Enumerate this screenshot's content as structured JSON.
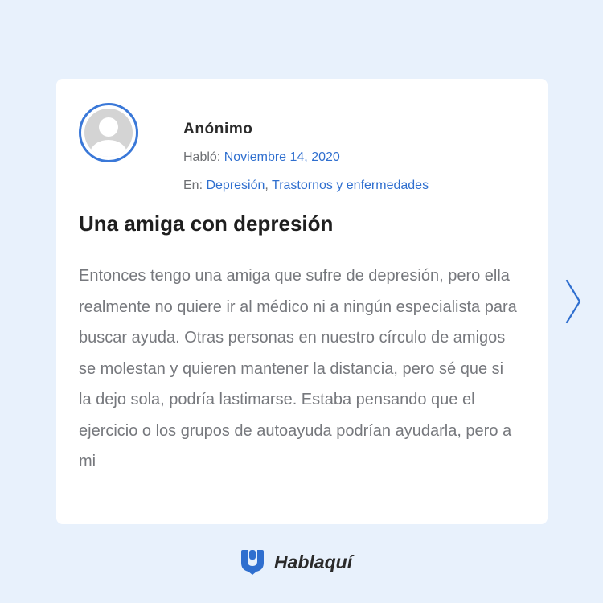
{
  "post": {
    "author": "Anónimo",
    "date_label": "Habló:",
    "date": "Noviembre 14, 2020",
    "category_label": "En:",
    "categories": [
      "Depresión",
      "Trastornos y enfermedades"
    ],
    "category_separator": ", ",
    "title": "Una amiga con depresión",
    "body": "Entonces tengo una amiga que sufre de depresión, pero ella realmente no quiere ir al médico ni a ningún especialista para buscar ayuda. Otras personas en nuestro círculo de amigos se molestan y quieren mantener la distancia, pero sé que si la dejo sola, podría lastimarse. Estaba pensando que el ejercicio o los grupos de autoayuda podrían ayudarla, pero a mi"
  },
  "nav": {
    "next_icon": "chevron-right-icon"
  },
  "brand": {
    "name": "Hablaquí",
    "logo_icon": "hablaqui-logo-icon"
  },
  "colors": {
    "background": "#e8f1fc",
    "accent": "#2f6fcf",
    "card": "#ffffff"
  }
}
